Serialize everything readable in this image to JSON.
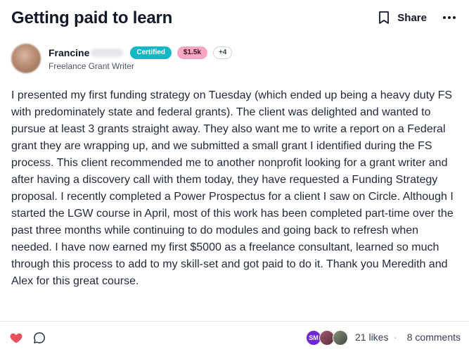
{
  "post": {
    "title": "Getting paid to learn",
    "body": "I presented my first funding strategy on Tuesday (which ended up being a heavy duty FS with predominately state and federal grants). The client was delighted and wanted to pursue at least 3 grants straight away. They also want me to write a report on a Federal grant they are wrapping up, and we submitted a small grant I identified during the FS process. This client recommended me to another nonprofit looking for a grant writer and after having a discovery call with them today, they have requested a Funding Strategy proposal. I recently completed a Power Prospectus for a client I saw on Circle. Although I started the LGW course in April, most of this work has been completed part-time over the past three months while continuing to do modules and going back to refresh when needed. I have now earned my first $5000 as a freelance consultant, learned so much through this process to add to my skill-set and got paid to do it.  Thank you Meredith and Alex for this great course."
  },
  "header": {
    "share_label": "Share",
    "icons": {
      "bookmark": "bookmark-icon",
      "more": "more-horizontal-icon"
    }
  },
  "author": {
    "name": "Francine",
    "role": "Freelance Grant Writer",
    "badges": {
      "certified": "Certified",
      "money": "$1.5k",
      "more": "+4"
    }
  },
  "footer": {
    "liker_initials": "SM",
    "likes": "21 likes",
    "separator": "·",
    "comments": "8 comments",
    "icons": {
      "like": "heart-icon",
      "comment": "comment-icon"
    }
  },
  "colors": {
    "certified_badge": "#14b8c4",
    "money_badge": "#f7a6c1",
    "liked_heart": "#e8505b"
  }
}
